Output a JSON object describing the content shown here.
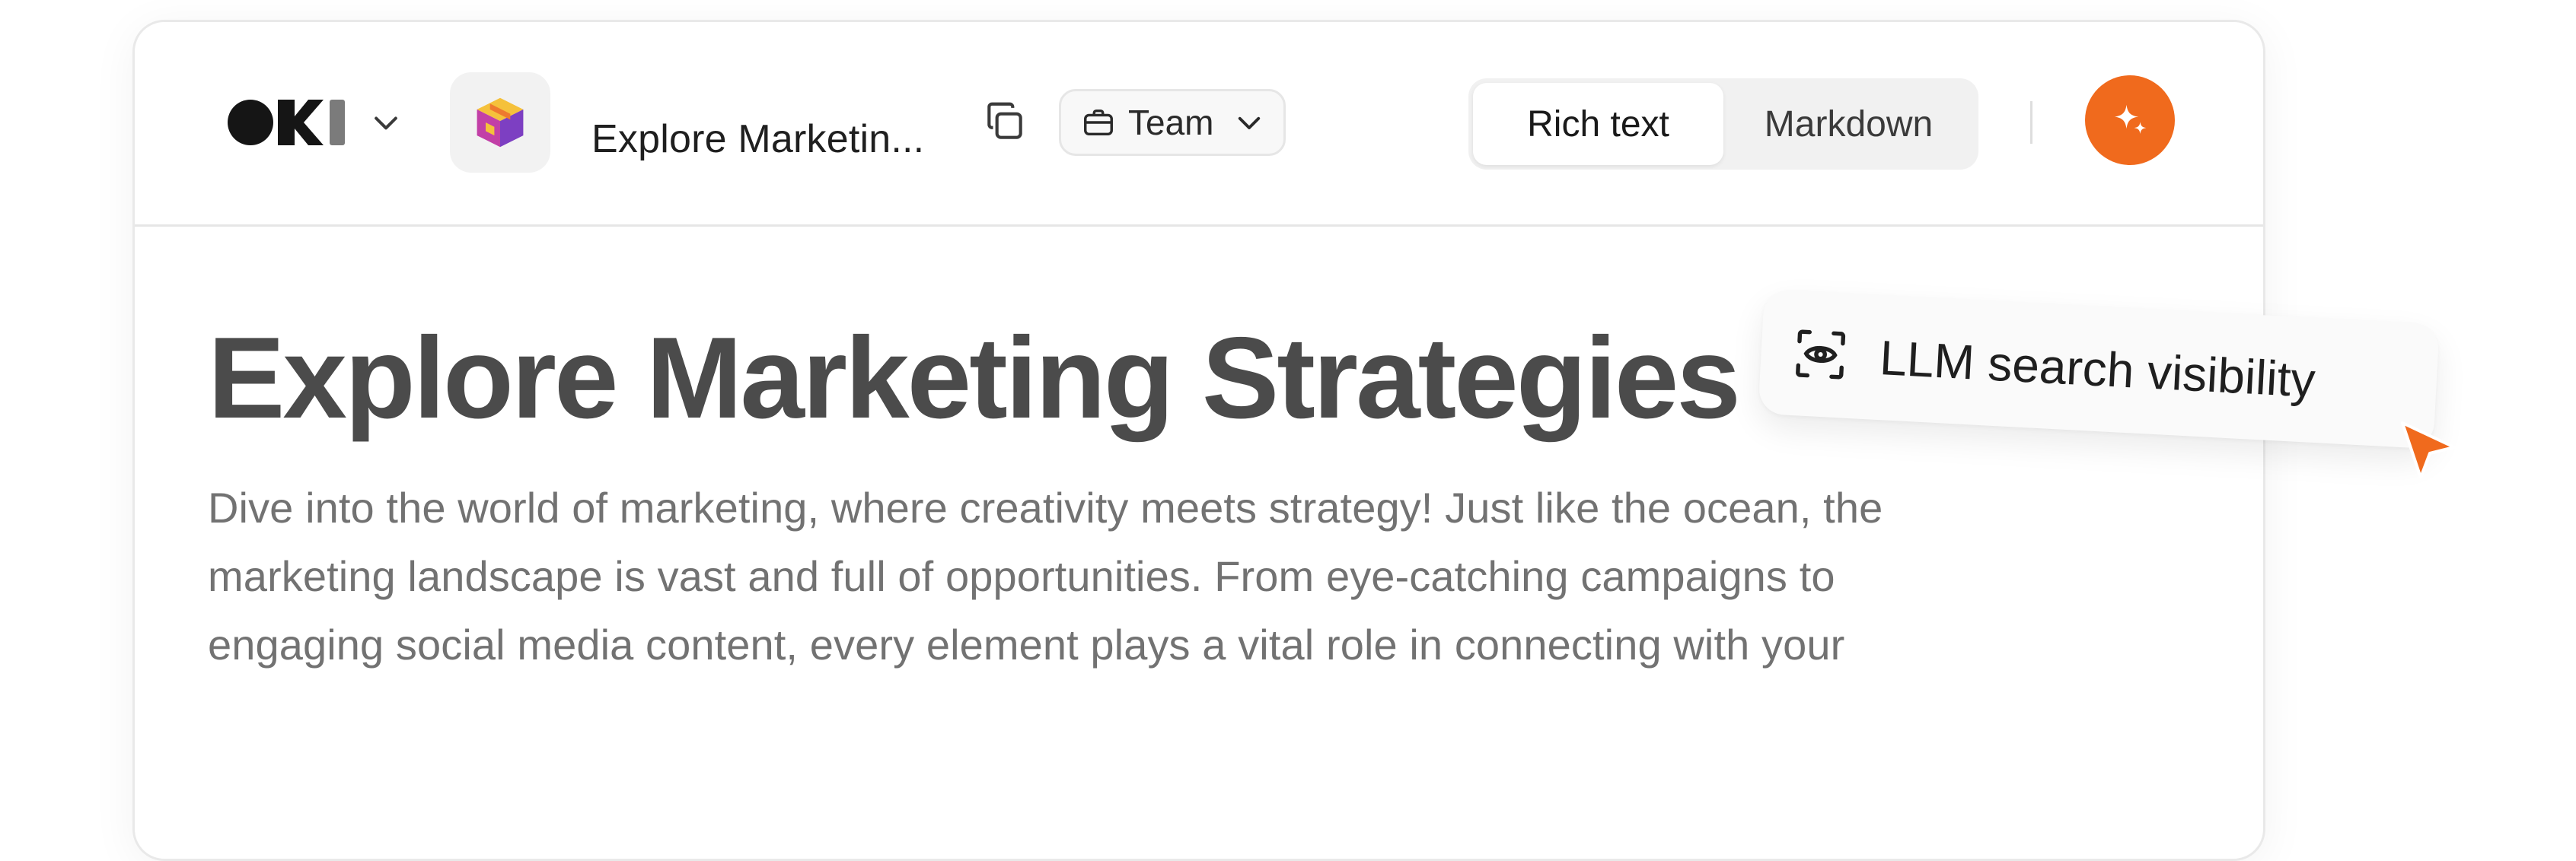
{
  "toolbar": {
    "brand_name": "OKI",
    "document_title": "Explore Marketin...",
    "team_label": "Team",
    "modes": [
      {
        "label": "Rich text",
        "active": true
      },
      {
        "label": "Markdown",
        "active": false
      }
    ],
    "icons": {
      "brand_caret": "chevron-down-icon",
      "doc_icon": "cube-icon",
      "copy": "copy-icon",
      "team": "briefcase-icon",
      "team_caret": "chevron-down-icon",
      "ai": "sparkle-icon"
    }
  },
  "content": {
    "title": "Explore Marketing Strategies",
    "body": "Dive into the world of marketing, where creativity meets strategy! Just like the ocean, the\nmarketing landscape is vast and full of opportunities. From eye-catching campaigns to\nengaging social media content, every element plays a vital role in connecting with your"
  },
  "overlay": {
    "chip_label": "LLM search visibility",
    "chip_icon": "eye-scan-icon",
    "cursor_icon": "cursor-arrow-icon"
  },
  "colors": {
    "accent": "#f06a1d",
    "title_text": "#4b4b4b",
    "body_text": "#727272",
    "border": "#e9e9e9"
  }
}
